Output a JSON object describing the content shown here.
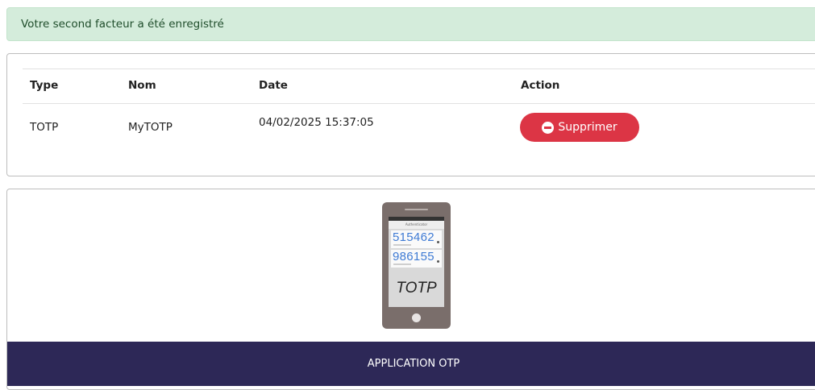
{
  "alert": {
    "message": "Votre second facteur a été enregistré"
  },
  "factors_table": {
    "columns": [
      "Type",
      "Nom",
      "Date",
      "Action"
    ],
    "rows": [
      {
        "type": "TOTP",
        "name": "MyTOTP",
        "date": "04/02/2025 15:37:05",
        "action_label": "Supprimer"
      }
    ]
  },
  "otp_app": {
    "phone_app_title": "Authenticator",
    "codes": [
      "515462",
      "986155"
    ],
    "phone_label": "TOTP",
    "footer_label": "APPLICATION OTP"
  },
  "colors": {
    "alert_bg": "#d4ecdb",
    "delete_button": "#dc3545",
    "footer_bg": "#2d2857"
  }
}
